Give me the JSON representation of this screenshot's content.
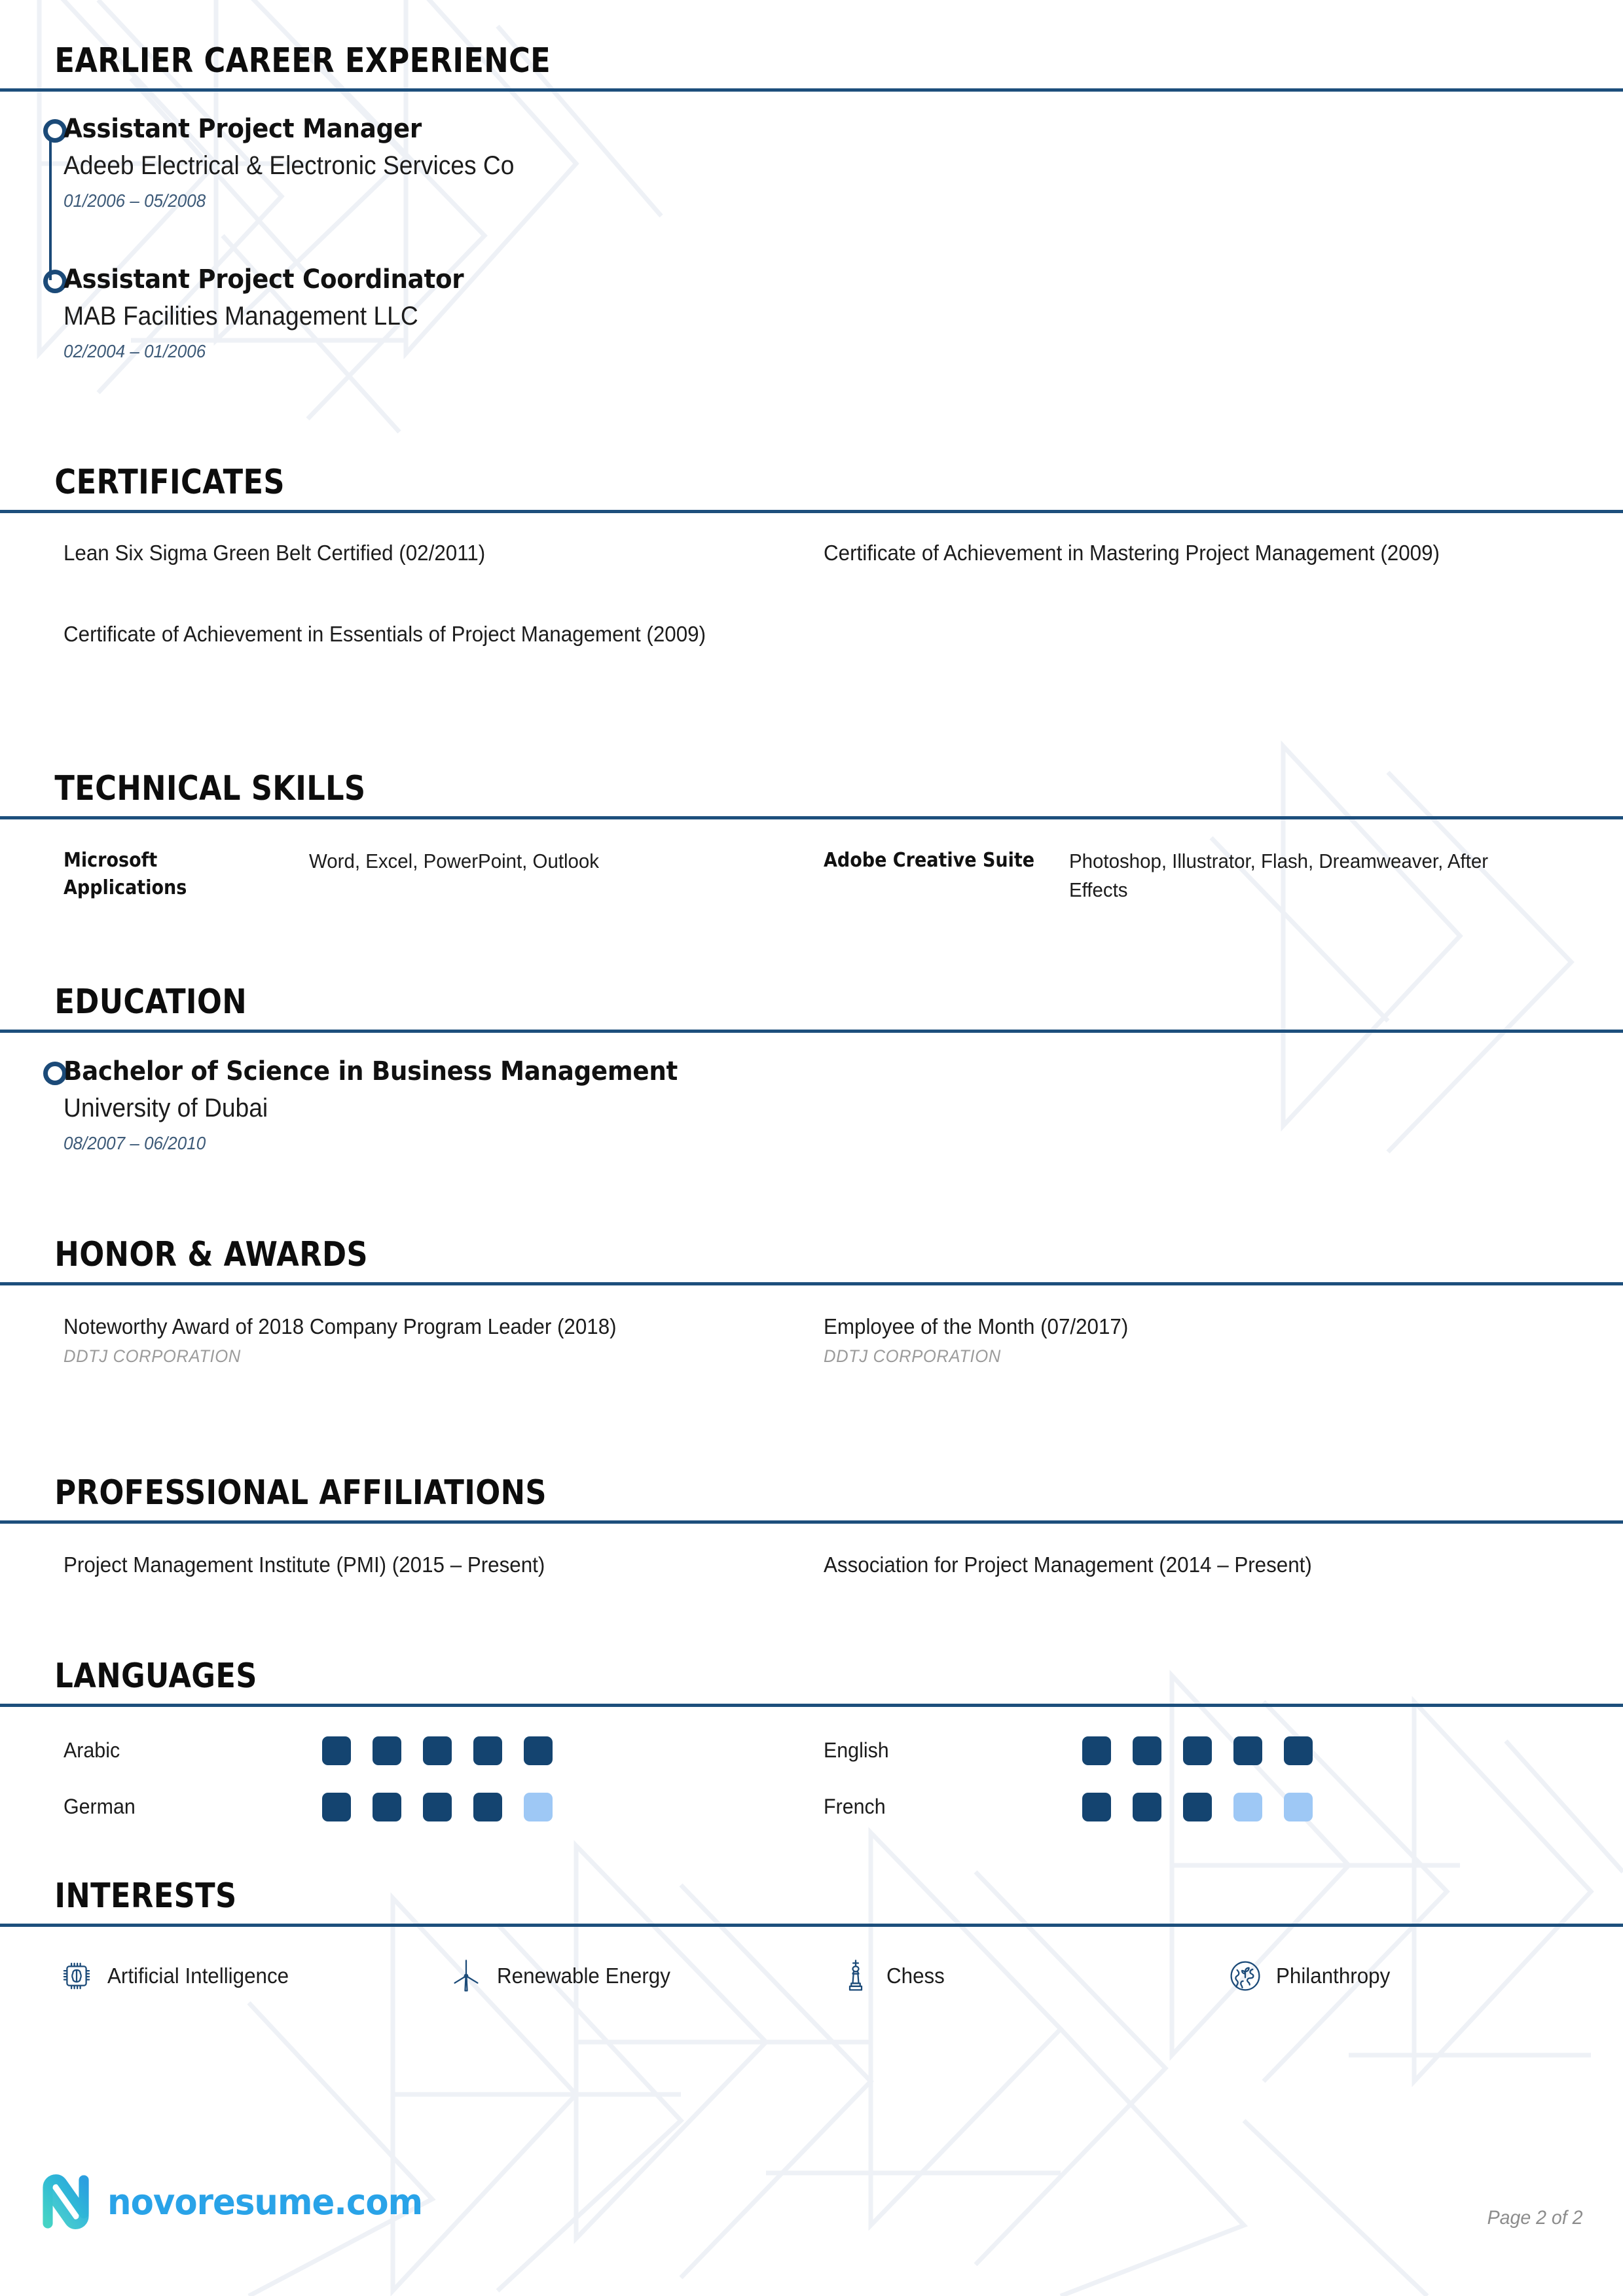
{
  "colors": {
    "rule": "#1d4f7c",
    "timeline": "#1b4a78",
    "pip_on": "#144470",
    "pip_off": "#9ec8f5",
    "date_text": "#3d5a78",
    "muted_text": "#9b9b9b",
    "logo_blue": "#29a3e8",
    "logo_teal": "#45d3c5",
    "watermark": "#eef1f6"
  },
  "sections": {
    "earlier_career": {
      "heading": "EARLIER CAREER EXPERIENCE",
      "entries": [
        {
          "title": "Assistant Project Manager",
          "organization": "Adeeb Electrical & Electronic Services Co",
          "dates": "01/2006 – 05/2008"
        },
        {
          "title": "Assistant Project Coordinator",
          "organization": "MAB Facilities Management LLC",
          "dates": "02/2004 – 01/2006"
        }
      ]
    },
    "certificates": {
      "heading": "CERTIFICATES",
      "left": [
        "Lean Six Sigma Green Belt Certified (02/2011)",
        "Certificate of Achievement in Essentials of Project Management (2009)"
      ],
      "right": [
        "Certificate of Achievement in Mastering Project Management (2009)"
      ]
    },
    "technical_skills": {
      "heading": "TECHNICAL SKILLS",
      "items": [
        {
          "label": "Microsoft Applications",
          "value": "Word, Excel, PowerPoint, Outlook"
        },
        {
          "label": "Adobe Creative Suite",
          "value": "Photoshop, Illustrator, Flash, Dreamweaver, After Effects"
        }
      ]
    },
    "education": {
      "heading": "EDUCATION",
      "entries": [
        {
          "degree": "Bachelor of Science in Business Management",
          "school": "University of Dubai",
          "dates": "08/2007 – 06/2010"
        }
      ]
    },
    "honors": {
      "heading": "HONOR & AWARDS",
      "items": [
        {
          "title": "Noteworthy Award of 2018 Company Program Leader (2018)",
          "org": "DDTJ CORPORATION"
        },
        {
          "title": "Employee of the Month (07/2017)",
          "org": "DDTJ CORPORATION"
        }
      ]
    },
    "affiliations": {
      "heading": "PROFESSIONAL AFFILIATIONS",
      "items": [
        "Project Management Institute (PMI) (2015 – Present)",
        "Association for Project Management (2014 – Present)"
      ]
    },
    "languages": {
      "heading": "LANGUAGES",
      "max_level": 5,
      "items": [
        {
          "name": "Arabic",
          "level": 5
        },
        {
          "name": "English",
          "level": 5
        },
        {
          "name": "German",
          "level": 4
        },
        {
          "name": "French",
          "level": 3
        }
      ]
    },
    "interests": {
      "heading": "INTERESTS",
      "items": [
        {
          "label": "Artificial Intelligence",
          "icon": "ai-chip-brain-icon"
        },
        {
          "label": "Renewable Energy",
          "icon": "wind-turbine-icon"
        },
        {
          "label": "Chess",
          "icon": "chess-king-icon"
        },
        {
          "label": "Philanthropy",
          "icon": "globe-plant-icon"
        }
      ]
    }
  },
  "footer": {
    "logo_text": "novoresume.com",
    "logo_mark": "novoresume-n-icon",
    "page_label": "Page 2 of 2"
  }
}
